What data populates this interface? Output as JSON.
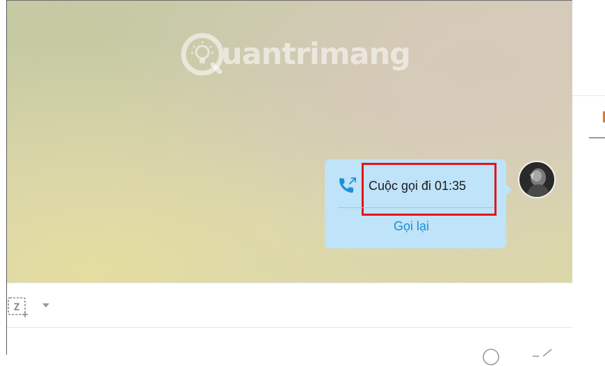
{
  "watermark": {
    "text": "uantrimang",
    "icon": "lightbulb-icon"
  },
  "message": {
    "icon": "outgoing-call-icon",
    "text": "Cuộc gọi đi 01:35",
    "action_label": "Gọi lại",
    "highlighted": true
  },
  "avatar": {
    "icon": "user-avatar"
  },
  "toolbar": {
    "screenshot_label": "Z"
  },
  "colors": {
    "bubble": "#bfe3f8",
    "link": "#1b8fd8",
    "highlight": "#e3141b",
    "accent": "#e07b2a"
  }
}
